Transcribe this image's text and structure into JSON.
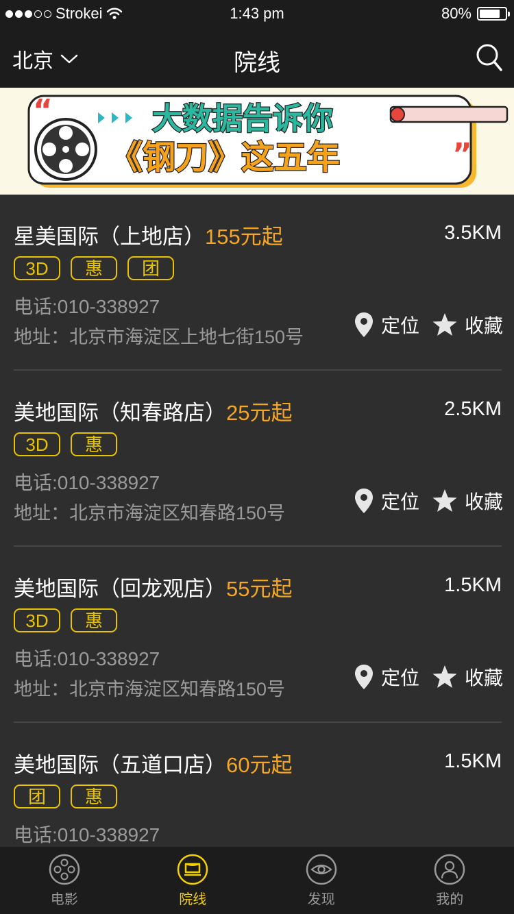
{
  "status_bar": {
    "carrier": "Strokei",
    "time": "1:43 pm",
    "battery": "80%",
    "battery_level": 0.8
  },
  "nav": {
    "city": "北京",
    "title": "院线"
  },
  "banner": {
    "line1": "大数据告诉你",
    "line2": "《钢刀》这五年"
  },
  "cinemas": [
    {
      "name": "星美国际（上地店）",
      "price": "155元起",
      "distance": "3.5KM",
      "tags": [
        "3D",
        "惠",
        "团"
      ],
      "phone": "电话:010-338927",
      "address": "地址：北京市海淀区上地七街150号",
      "locate": "定位",
      "favorite": "收藏"
    },
    {
      "name": "美地国际（知春路店）",
      "price": "25元起",
      "distance": "2.5KM",
      "tags": [
        "3D",
        "惠"
      ],
      "phone": "电话:010-338927",
      "address": "地址：北京市海淀区知春路150号",
      "locate": "定位",
      "favorite": "收藏"
    },
    {
      "name": "美地国际（回龙观店）",
      "price": "55元起",
      "distance": "1.5KM",
      "tags": [
        "3D",
        "惠"
      ],
      "phone": "电话:010-338927",
      "address": "地址：北京市海淀区知春路150号",
      "locate": "定位",
      "favorite": "收藏"
    },
    {
      "name": "美地国际（五道口店）",
      "price": "60元起",
      "distance": "1.5KM",
      "tags": [
        "团",
        "惠"
      ],
      "phone": "电话:010-338927",
      "address": "",
      "locate": "",
      "favorite": ""
    }
  ],
  "tabs": [
    {
      "label": "电影",
      "icon": "film-reel-icon",
      "active": false
    },
    {
      "label": "院线",
      "icon": "cinema-screen-icon",
      "active": true
    },
    {
      "label": "发现",
      "icon": "eye-icon",
      "active": false
    },
    {
      "label": "我的",
      "icon": "user-icon",
      "active": false
    }
  ],
  "colors": {
    "accent": "#f5a623",
    "tag": "#e8c300",
    "tab_active": "#f5d000",
    "background": "#2e2e2e",
    "bar": "#1c1c1c"
  }
}
